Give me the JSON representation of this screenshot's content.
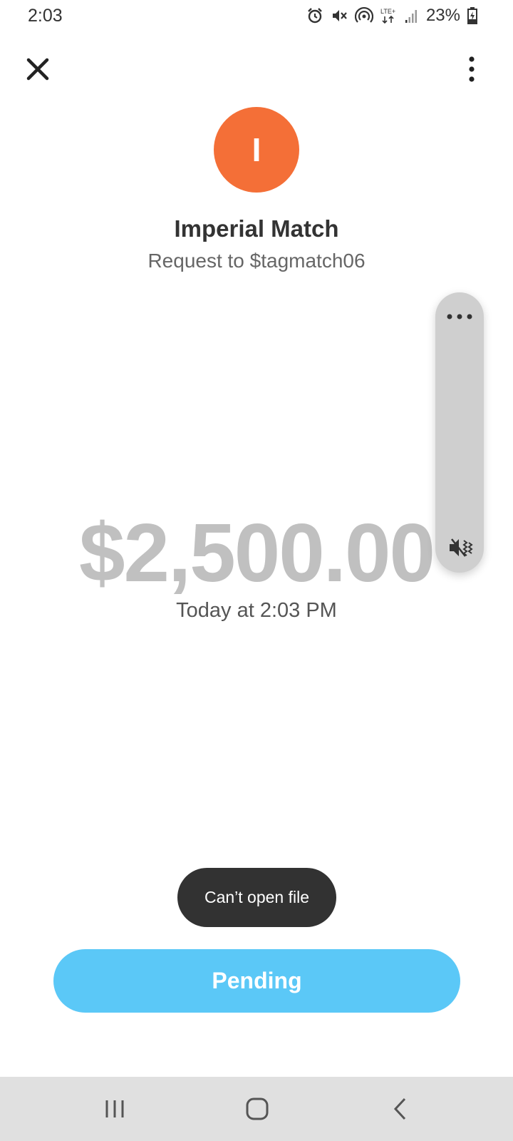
{
  "status_bar": {
    "time": "2:03",
    "battery_percent": "23%",
    "icons": [
      "alarm-icon",
      "mute-icon",
      "hotspot-icon",
      "lte-icon",
      "signal-icon",
      "battery-charging-icon"
    ]
  },
  "header": {
    "close_icon": "close-icon",
    "more_icon": "more-vertical-icon"
  },
  "contact": {
    "initial": "I",
    "name": "Imperial Match",
    "subtitle": "Request to $tagmatch06",
    "avatar_color": "#F46F37"
  },
  "payment": {
    "amount": "$2,500.00",
    "time": "Today at 2:03 PM"
  },
  "volume_panel": {
    "more_icon": "more-horizontal-icon",
    "mute_icon": "mute-vibrate-icon"
  },
  "toast": {
    "text": "Can’t open file"
  },
  "action": {
    "label": "Pending",
    "color": "#5BC8F7"
  },
  "nav_bar": {
    "icons": [
      "recent-apps-icon",
      "home-icon",
      "back-icon"
    ]
  }
}
